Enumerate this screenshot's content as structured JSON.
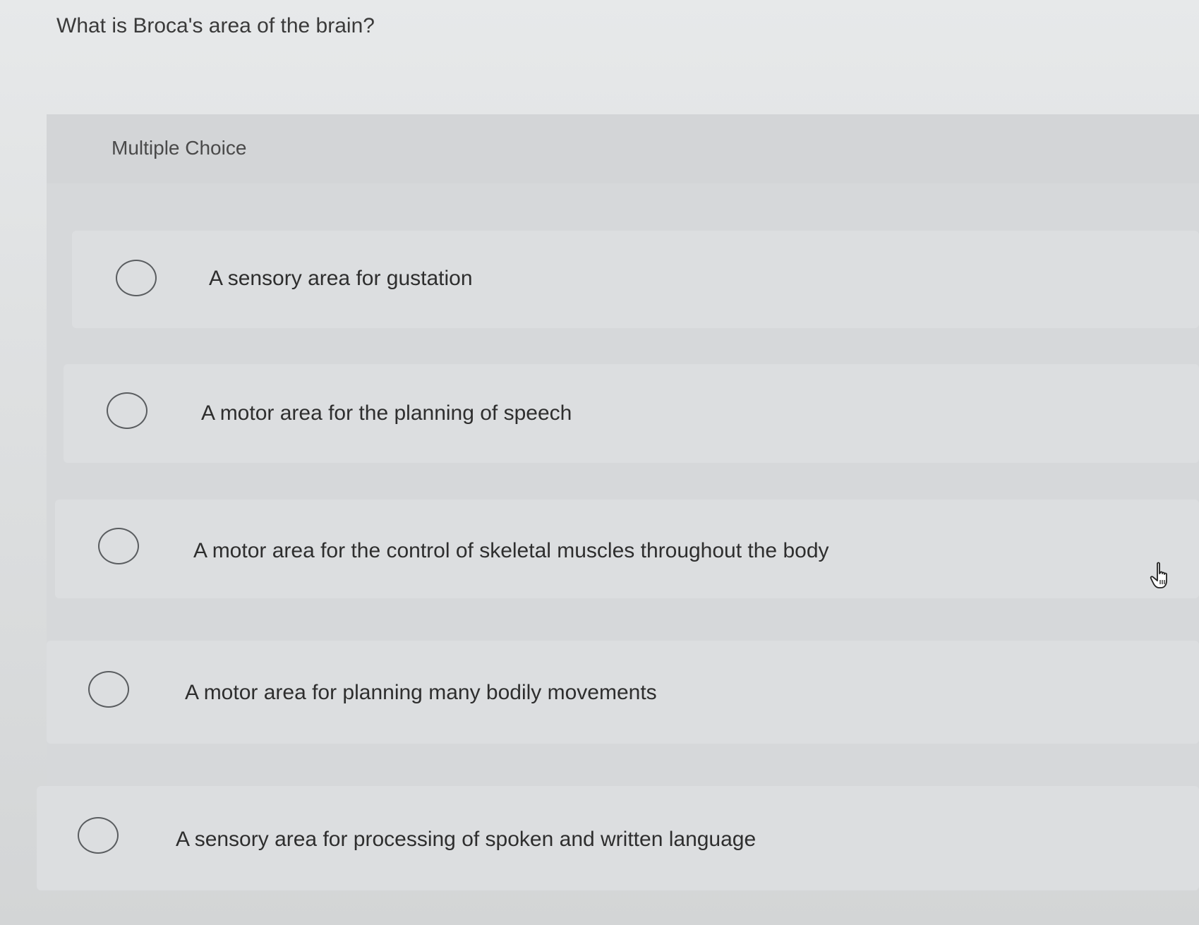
{
  "question": {
    "text": "What is Broca's area of the brain?"
  },
  "section": {
    "label": "Multiple Choice"
  },
  "options": [
    {
      "label": "A sensory area for gustation"
    },
    {
      "label": "A motor area for the planning of speech"
    },
    {
      "label": "A motor area for the control of skeletal muscles throughout the body"
    },
    {
      "label": "A motor area for planning many bodily movements"
    },
    {
      "label": "A sensory area for processing of spoken and written language"
    }
  ],
  "cursor": {
    "icon": "hand-pointer-icon"
  }
}
